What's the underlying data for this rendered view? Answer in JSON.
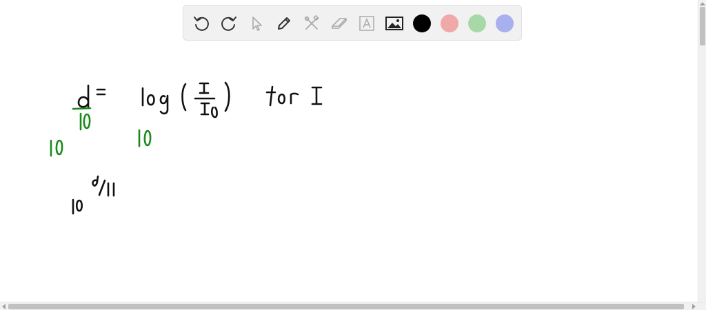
{
  "toolbar": {
    "tools": [
      {
        "name": "undo-icon",
        "label": "undo"
      },
      {
        "name": "redo-icon",
        "label": "redo"
      },
      {
        "name": "pointer-icon",
        "label": "select"
      },
      {
        "name": "pen-icon",
        "label": "pen"
      },
      {
        "name": "tools-icon",
        "label": "tools"
      },
      {
        "name": "eraser-icon",
        "label": "eraser"
      },
      {
        "name": "text-icon",
        "label": "A"
      },
      {
        "name": "image-icon",
        "label": "image"
      }
    ],
    "colors": [
      "#000000",
      "#f0a8a8",
      "#a8d8a8",
      "#a8b0f0"
    ]
  },
  "ink_colors": {
    "black": "#111111",
    "green": "#1a8a1a"
  }
}
